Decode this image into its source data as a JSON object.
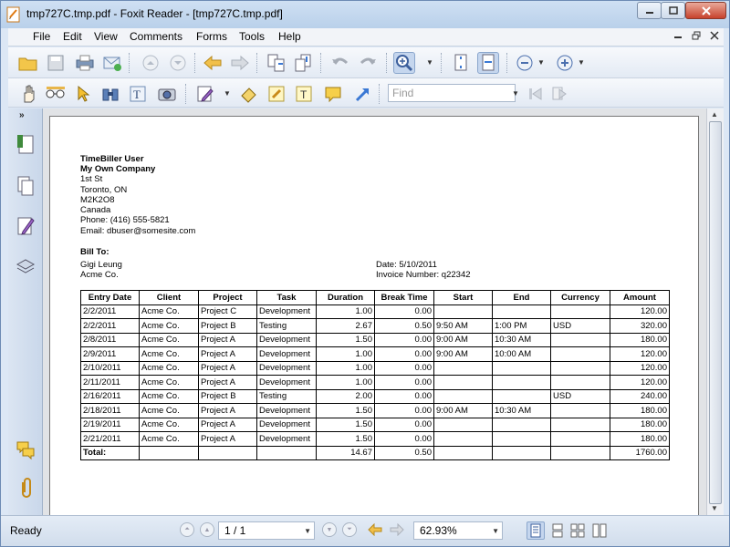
{
  "window": {
    "title": "tmp727C.tmp.pdf - Foxit Reader - [tmp727C.tmp.pdf]"
  },
  "menu": [
    "File",
    "Edit",
    "View",
    "Comments",
    "Forms",
    "Tools",
    "Help"
  ],
  "find": {
    "placeholder": "Find"
  },
  "document": {
    "sender": {
      "name": "TimeBiller User",
      "company": "My Own Company",
      "street": "1st St",
      "city": "Toronto, ON",
      "postal": "M2K2O8",
      "country": "Canada",
      "phone": "Phone: (416) 555-5821",
      "email": "Email: dbuser@somesite.com"
    },
    "bill_to_label": "Bill To:",
    "bill_to": {
      "name": "Gigi Leung",
      "company": "Acme Co."
    },
    "date": "Date: 5/10/2011",
    "invoice_number": "Invoice Number: q22342",
    "table": {
      "headers": [
        "Entry Date",
        "Client",
        "Project",
        "Task",
        "Duration",
        "Break Time",
        "Start",
        "End",
        "Currency",
        "Amount"
      ],
      "rows": [
        [
          "2/2/2011",
          "Acme Co.",
          "Project C",
          "Development",
          "1.00",
          "0.00",
          "",
          "",
          "",
          "120.00"
        ],
        [
          "2/2/2011",
          "Acme Co.",
          "Project B",
          "Testing",
          "2.67",
          "0.50",
          "9:50 AM",
          "1:00 PM",
          "USD",
          "320.00"
        ],
        [
          "2/8/2011",
          "Acme Co.",
          "Project A",
          "Development",
          "1.50",
          "0.00",
          "9:00 AM",
          "10:30 AM",
          "",
          "180.00"
        ],
        [
          "2/9/2011",
          "Acme Co.",
          "Project A",
          "Development",
          "1.00",
          "0.00",
          "9:00 AM",
          "10:00 AM",
          "",
          "120.00"
        ],
        [
          "2/10/2011",
          "Acme Co.",
          "Project A",
          "Development",
          "1.00",
          "0.00",
          "",
          "",
          "",
          "120.00"
        ],
        [
          "2/11/2011",
          "Acme Co.",
          "Project A",
          "Development",
          "1.00",
          "0.00",
          "",
          "",
          "",
          "120.00"
        ],
        [
          "2/16/2011",
          "Acme Co.",
          "Project B",
          "Testing",
          "2.00",
          "0.00",
          "",
          "",
          "USD",
          "240.00"
        ],
        [
          "2/18/2011",
          "Acme Co.",
          "Project A",
          "Development",
          "1.50",
          "0.00",
          "9:00 AM",
          "10:30 AM",
          "",
          "180.00"
        ],
        [
          "2/19/2011",
          "Acme Co.",
          "Project A",
          "Development",
          "1.50",
          "0.00",
          "",
          "",
          "",
          "180.00"
        ],
        [
          "2/21/2011",
          "Acme Co.",
          "Project A",
          "Development",
          "1.50",
          "0.00",
          "",
          "",
          "",
          "180.00"
        ]
      ],
      "total": {
        "label": "Total:",
        "duration": "14.67",
        "break_time": "0.50",
        "amount": "1760.00"
      }
    }
  },
  "status": {
    "text": "Ready",
    "page": "1 / 1",
    "zoom": "62.93%"
  }
}
